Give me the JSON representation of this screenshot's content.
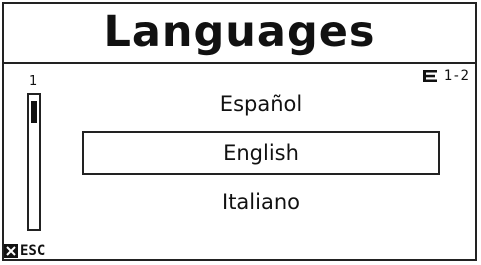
{
  "header": {
    "title": "Languages"
  },
  "scrollbar": {
    "position_label": "1",
    "thumb_position": 0
  },
  "page_indicator": {
    "icon": "list-page-icon",
    "text": "1-2"
  },
  "languages": [
    {
      "label": "Español",
      "selected": false
    },
    {
      "label": "English",
      "selected": true
    },
    {
      "label": "Italiano",
      "selected": false
    }
  ],
  "footer": {
    "esc_icon": "back-icon",
    "esc_label": "ESC"
  },
  "colors": {
    "foreground": "#111111",
    "background": "#ffffff",
    "border": "#222222"
  }
}
